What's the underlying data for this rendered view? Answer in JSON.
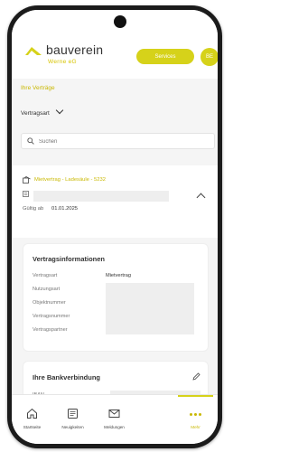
{
  "header": {
    "logo_name": "bauverein",
    "logo_sub": "Werne eG",
    "services_label": "Services",
    "avatar_initials": "BE",
    "accent_color": "#d6d21a"
  },
  "page": {
    "title": "Ihre Verträge",
    "filter_label": "Vertragsart",
    "search_placeholder": "Suchen"
  },
  "contract": {
    "title": "Mietvertrag - Ladesäule - 5232",
    "valid_label": "Gültig ab",
    "valid_value": "01.01.2025"
  },
  "info": {
    "title": "Vertragsinformationen",
    "rows": [
      "Vertragsart",
      "Nutzungsart",
      "Objektnummer",
      "Vertragsnummer",
      "Vertragspartner"
    ],
    "vertragsart_value": "Mietvertrag"
  },
  "bank": {
    "title": "Ihre Bankverbindung",
    "iban_label": "IBAN"
  },
  "nav": {
    "items": [
      {
        "label": "Startseite",
        "icon": "home-icon"
      },
      {
        "label": "Neuigkeiten",
        "icon": "news-icon"
      },
      {
        "label": "Meldungen",
        "icon": "mail-icon"
      },
      {
        "label": "",
        "icon": ""
      },
      {
        "label": "Mehr",
        "icon": "more-icon"
      }
    ],
    "active": "Mehr"
  }
}
